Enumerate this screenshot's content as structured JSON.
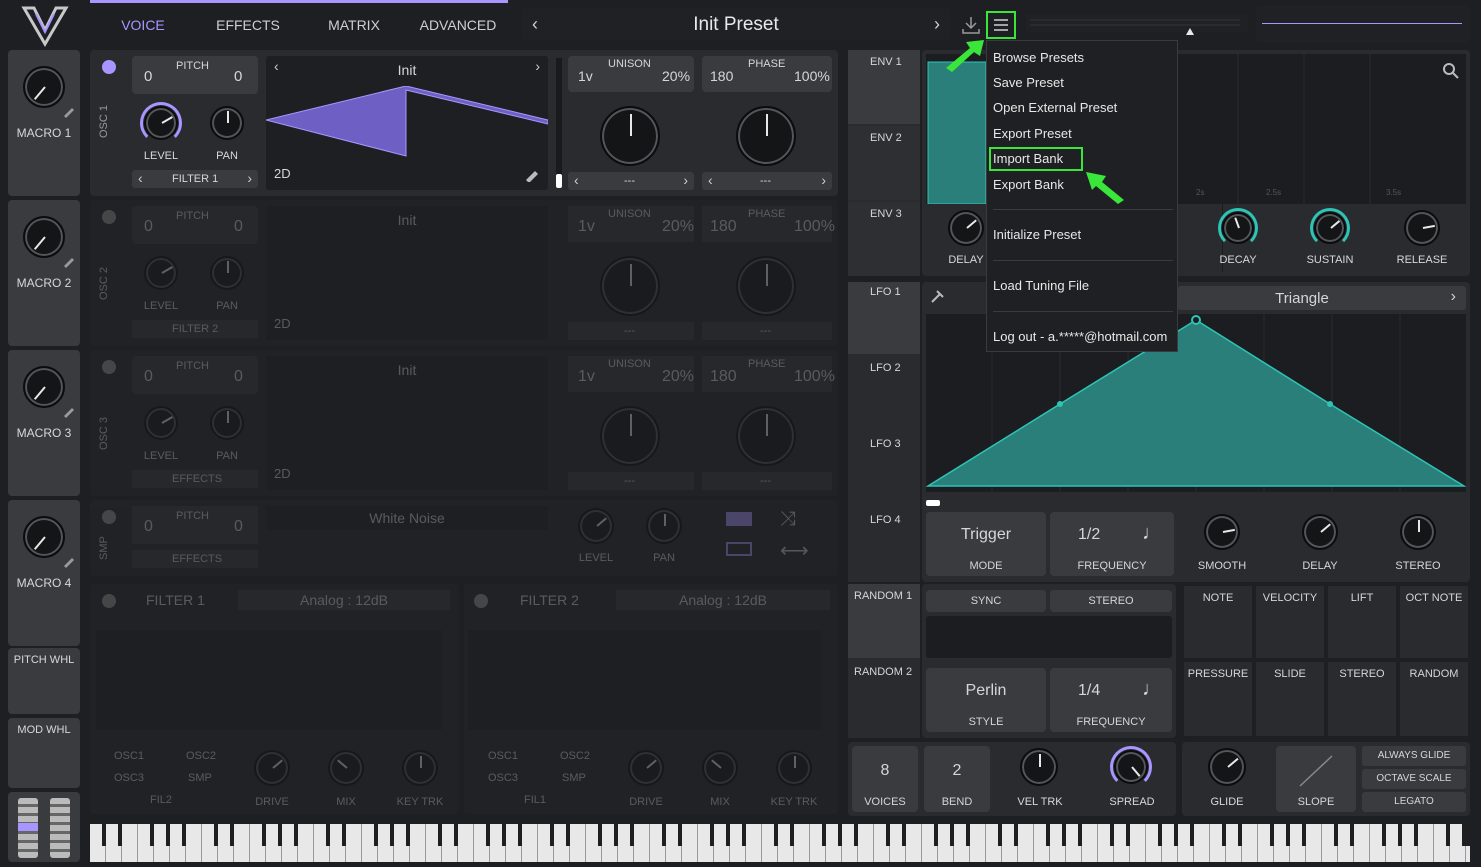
{
  "nav": {
    "tabs": [
      "VOICE",
      "EFFECTS",
      "MATRIX",
      "ADVANCED"
    ],
    "preset": "Init Preset"
  },
  "menu": {
    "items": [
      "Browse Presets",
      "Save Preset",
      "Open External Preset",
      "Export Preset",
      "Import Bank",
      "Export Bank",
      "Initialize Preset",
      "Load Tuning File",
      "Log out - a.*****@hotmail.com"
    ]
  },
  "macros": [
    "MACRO 1",
    "MACRO 2",
    "MACRO 3",
    "MACRO 4"
  ],
  "wheels": [
    "PITCH WHL",
    "MOD WHL"
  ],
  "osc1": {
    "label": "OSC 1",
    "pitch": "PITCH",
    "pitch_a": "0",
    "pitch_b": "0",
    "level": "LEVEL",
    "pan": "PAN",
    "filter": "FILTER 1",
    "wave": "Init",
    "mode": "2D",
    "unison": "UNISON",
    "unison_v": "1v",
    "unison_p": "20%",
    "phase": "PHASE",
    "phase_a": "180",
    "phase_b": "100%",
    "dash1": "---",
    "dash2": "---"
  },
  "osc2": {
    "label": "OSC 2",
    "pitch": "PITCH",
    "pitch_a": "0",
    "pitch_b": "0",
    "level": "LEVEL",
    "pan": "PAN",
    "filter": "FILTER 2",
    "wave": "Init",
    "mode": "2D",
    "unison": "UNISON",
    "unison_v": "1v",
    "unison_p": "20%",
    "phase": "PHASE",
    "phase_a": "180",
    "phase_b": "100%",
    "dash1": "---",
    "dash2": "---"
  },
  "osc3": {
    "label": "OSC 3",
    "pitch": "PITCH",
    "pitch_a": "0",
    "pitch_b": "0",
    "level": "LEVEL",
    "pan": "PAN",
    "filter": "EFFECTS",
    "wave": "Init",
    "mode": "2D",
    "unison": "UNISON",
    "unison_v": "1v",
    "unison_p": "20%",
    "phase": "PHASE",
    "phase_a": "180",
    "phase_b": "100%",
    "dash1": "---",
    "dash2": "---"
  },
  "smp": {
    "label": "SMP",
    "pitch": "PITCH",
    "pitch_a": "0",
    "pitch_b": "0",
    "effects": "EFFECTS",
    "sample": "White Noise",
    "level": "LEVEL",
    "pan": "PAN"
  },
  "filter1": {
    "title": "FILTER 1",
    "model": "Analog : 12dB",
    "src": [
      "OSC1",
      "OSC2",
      "OSC3",
      "SMP",
      "FIL2"
    ],
    "drive": "DRIVE",
    "mix": "MIX",
    "keytrk": "KEY TRK"
  },
  "filter2": {
    "title": "FILTER 2",
    "model": "Analog : 12dB",
    "src": [
      "OSC1",
      "OSC2",
      "OSC3",
      "SMP",
      "FIL1"
    ],
    "drive": "DRIVE",
    "mix": "MIX",
    "keytrk": "KEY TRK"
  },
  "env": {
    "tabs": [
      "ENV 1",
      "ENV 2",
      "ENV 3"
    ],
    "knobs": [
      "DELAY",
      "DECAY",
      "SUSTAIN",
      "RELEASE"
    ],
    "ticks": [
      "2s",
      "2.5s",
      "3.5s"
    ]
  },
  "lfo": {
    "tabs": [
      "LFO 1",
      "LFO 2",
      "LFO 3",
      "LFO 4"
    ],
    "shape": "Triangle",
    "mode": "Trigger",
    "mode_label": "MODE",
    "freq": "1/2",
    "freq_label": "FREQUENCY",
    "knobs": [
      "SMOOTH",
      "DELAY",
      "STEREO"
    ]
  },
  "random": {
    "tabs": [
      "RANDOM 1",
      "RANDOM 2"
    ],
    "sync": "SYNC",
    "stereo": "STEREO",
    "style": "Perlin",
    "style_label": "STYLE",
    "freq": "1/4",
    "freq_label": "FREQUENCY"
  },
  "modsources": [
    "NOTE",
    "VELOCITY",
    "LIFT",
    "OCT NOTE",
    "PRESSURE",
    "SLIDE",
    "STEREO",
    "RANDOM"
  ],
  "voice": {
    "voices": "8",
    "voices_label": "VOICES",
    "bend": "2",
    "bend_label": "BEND",
    "veltrk": "VEL TRK",
    "spread": "SPREAD"
  },
  "glide": {
    "glide": "GLIDE",
    "slope": "SLOPE",
    "always": "ALWAYS GLIDE",
    "octave": "OCTAVE SCALE",
    "legato": "LEGATO"
  },
  "colors": {
    "accent": "#a995ff",
    "teal": "#2ec4b6",
    "highlight": "#39e639"
  }
}
